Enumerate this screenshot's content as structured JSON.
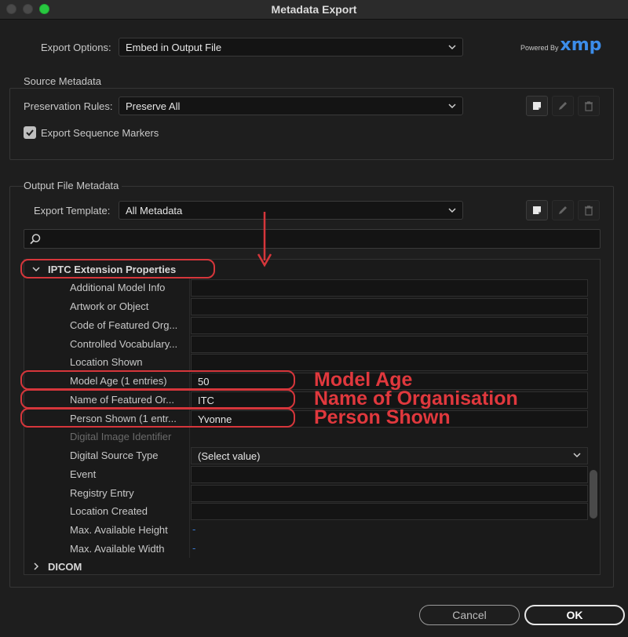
{
  "window": {
    "title": "Metadata Export"
  },
  "export_options": {
    "label": "Export Options:",
    "value": "Embed in Output File"
  },
  "branding": {
    "powered_by": "Powered By",
    "logo": "xmp"
  },
  "source_metadata": {
    "title": "Source Metadata",
    "preservation_label": "Preservation Rules:",
    "preservation_value": "Preserve All",
    "export_markers_label": "Export Sequence Markers",
    "export_markers_checked": true
  },
  "output_metadata": {
    "title": "Output File Metadata",
    "template_label": "Export Template:",
    "template_value": "All Metadata",
    "search_placeholder": ""
  },
  "tree": {
    "section_iptc": "IPTC Extension Properties",
    "section_dicom": "DICOM",
    "rows": [
      {
        "label": "Additional Model Info",
        "value": ""
      },
      {
        "label": "Artwork or Object",
        "value": ""
      },
      {
        "label": "Code of Featured Org...",
        "value": ""
      },
      {
        "label": "Controlled Vocabulary...",
        "value": ""
      },
      {
        "label": "Location Shown",
        "value": ""
      },
      {
        "label": "Model Age (1 entries)",
        "value": "50"
      },
      {
        "label": "Name of Featured Or...",
        "value": "ITC"
      },
      {
        "label": "Person Shown (1 entr...",
        "value": "Yvonne"
      },
      {
        "label": "Digital Image Identifier",
        "value": ""
      },
      {
        "label": "Digital Source Type",
        "value": "(Select value)"
      },
      {
        "label": "Event",
        "value": ""
      },
      {
        "label": "Registry Entry",
        "value": ""
      },
      {
        "label": "Location Created",
        "value": ""
      },
      {
        "label": "Max. Available Height",
        "value": "-"
      },
      {
        "label": "Max. Available Width",
        "value": "-"
      }
    ]
  },
  "annotations": {
    "model_age": "Model Age",
    "name_of_org": "Name of Organisation",
    "person_shown": "Person Shown"
  },
  "buttons": {
    "cancel": "Cancel",
    "ok": "OK"
  },
  "colors": {
    "annotation_red": "#d6363b",
    "xmp_blue": "#3c8dea",
    "checkbox": "#bfbfbf"
  }
}
